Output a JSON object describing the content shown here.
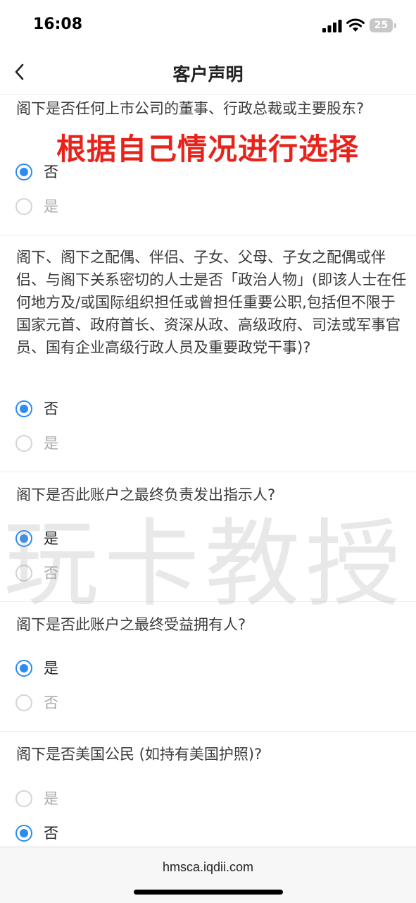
{
  "status_bar": {
    "time": "16:08",
    "battery": "25"
  },
  "nav": {
    "title": "客户声明"
  },
  "overlay_text": "根据自己情况进行选择",
  "watermark": "玩卡教授",
  "questions": [
    {
      "text": "阁下是否任何上市公司的董事、行政总裁或主要股东?",
      "options": [
        {
          "label": "否",
          "checked": true
        },
        {
          "label": "是",
          "checked": false
        }
      ]
    },
    {
      "text": "阁下、阁下之配偶、伴侣、子女、父母、子女之配偶或伴侣、与阁下关系密切的人士是否「政治人物」(即该人士在任何地方及/或国际组织担任或曾担任重要公职,包括但不限于国家元首、政府首长、资深从政、高级政府、司法或军事官员、国有企业高级行政人员及重要政党干事)?",
      "options": [
        {
          "label": "否",
          "checked": true
        },
        {
          "label": "是",
          "checked": false
        }
      ]
    },
    {
      "text": "阁下是否此账户之最终负责发出指示人?",
      "options": [
        {
          "label": "是",
          "checked": true
        },
        {
          "label": "否",
          "checked": false
        }
      ]
    },
    {
      "text": "阁下是否此账户之最终受益拥有人?",
      "options": [
        {
          "label": "是",
          "checked": true
        },
        {
          "label": "否",
          "checked": false
        }
      ]
    },
    {
      "text": "阁下是否美国公民 (如持有美国护照)?",
      "options": [
        {
          "label": "是",
          "checked": false
        },
        {
          "label": "否",
          "checked": true
        }
      ]
    }
  ],
  "footer": {
    "url": "hmsca.iqdii.com"
  },
  "accent_color": "#2d8cf0",
  "overlay_color": "#e8231b"
}
